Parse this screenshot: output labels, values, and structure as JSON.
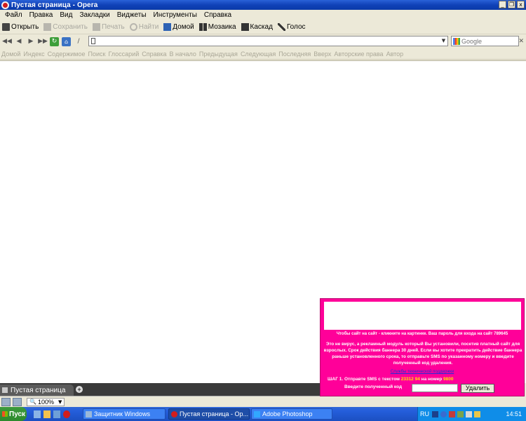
{
  "window": {
    "title": "Пустая страница - Opera",
    "controls": [
      "_",
      "❐",
      "x"
    ]
  },
  "menu": [
    "Файл",
    "Правка",
    "Вид",
    "Закладки",
    "Виджеты",
    "Инструменты",
    "Справка"
  ],
  "toolbar": {
    "open": "Открыть",
    "save": "Сохранить",
    "print": "Печать",
    "find": "Найти",
    "home": "Домой",
    "tile": "Мозаика",
    "cascade": "Каскад",
    "voice": "Голос"
  },
  "address": {
    "value": "",
    "search_placeholder": "Google"
  },
  "navbar": [
    "Домой",
    "Индекс",
    "Содержимое",
    "Поиск",
    "Глоссарий",
    "Справка",
    "В начало",
    "Предыдущая",
    "Следующая",
    "Последняя",
    "Вверх",
    "Авторские права",
    "Автор"
  ],
  "banner": {
    "line1": "Чтобы сайт на сайт - кликните на картинке. Ваш пароль для входа на сайт 789645",
    "para": "Это не вирус, а рекламный модуль который Вы установили, посетив платный сайт для взрослых. Срок действия баннера 30 дней. Если вы хотите прекратить действие баннера раньше установленного срока, то отправьте SMS по указанному номеру и введите полученный код удаления.",
    "support": "Службы технической поддержки",
    "step_prefix": "ШАГ 1. Отправте SMS с текстом",
    "sms_text": "23312 94",
    "step_mid": "на номер",
    "sms_number": "9800",
    "code_label": "Введите полученный код",
    "delete_button": "Удалить"
  },
  "tab": {
    "label": "Пустая страница"
  },
  "status": {
    "zoom": "100%"
  },
  "taskbar": {
    "start": "Пуск",
    "tasks": [
      "Защитник Windows",
      "Пустая страница - Ор...",
      "Adobe Photoshop"
    ],
    "lang": "RU",
    "clock": "14:51"
  }
}
